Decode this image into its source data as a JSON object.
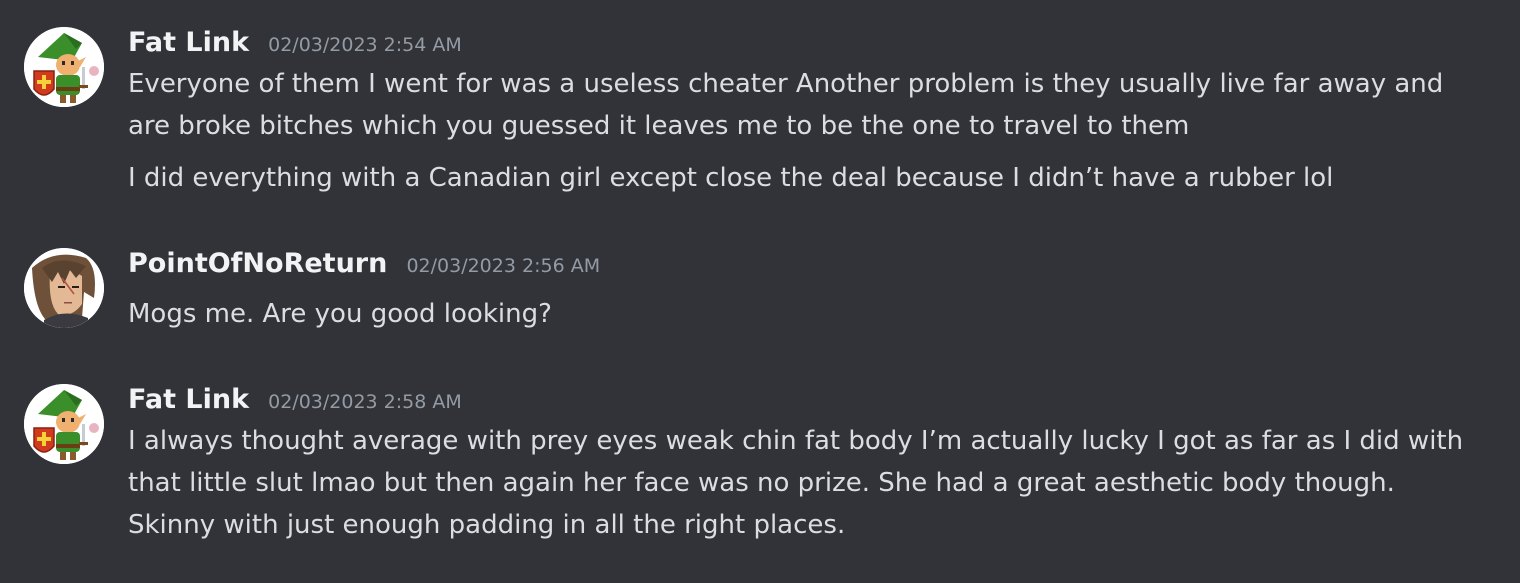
{
  "messages": [
    {
      "username": "Fat Link",
      "timestamp": "02/03/2023 2:54 AM",
      "avatar": "link-icon",
      "paragraphs": [
        {
          "lines": [
            "Everyone of them I went for was a useless cheater Another problem is they usually live far away and",
            "are broke bitches which you guessed it leaves me to be the one to travel to them"
          ]
        },
        {
          "lines": [
            "I did everything with a Canadian girl except close the deal because I didn’t have a rubber lol"
          ]
        }
      ]
    },
    {
      "username": "PointOfNoReturn",
      "timestamp": "02/03/2023 2:56 AM",
      "avatar": "squall-icon",
      "paragraphs": [
        {
          "lines": [
            "Mogs me. Are you good looking?"
          ]
        }
      ]
    },
    {
      "username": "Fat Link",
      "timestamp": "02/03/2023 2:58 AM",
      "avatar": "link-icon",
      "paragraphs": [
        {
          "lines": [
            "I always thought average with prey eyes weak chin fat body I’m actually lucky I got as far as I did with",
            "that little slut lmao but then again her face was no prize. She had a great aesthetic body though.",
            "Skinny with just enough padding in all the right places."
          ]
        }
      ]
    }
  ],
  "colors": {
    "background": "#313338",
    "username": "#f2f3f5",
    "timestamp": "#949ba4",
    "text": "#dbdee1"
  }
}
